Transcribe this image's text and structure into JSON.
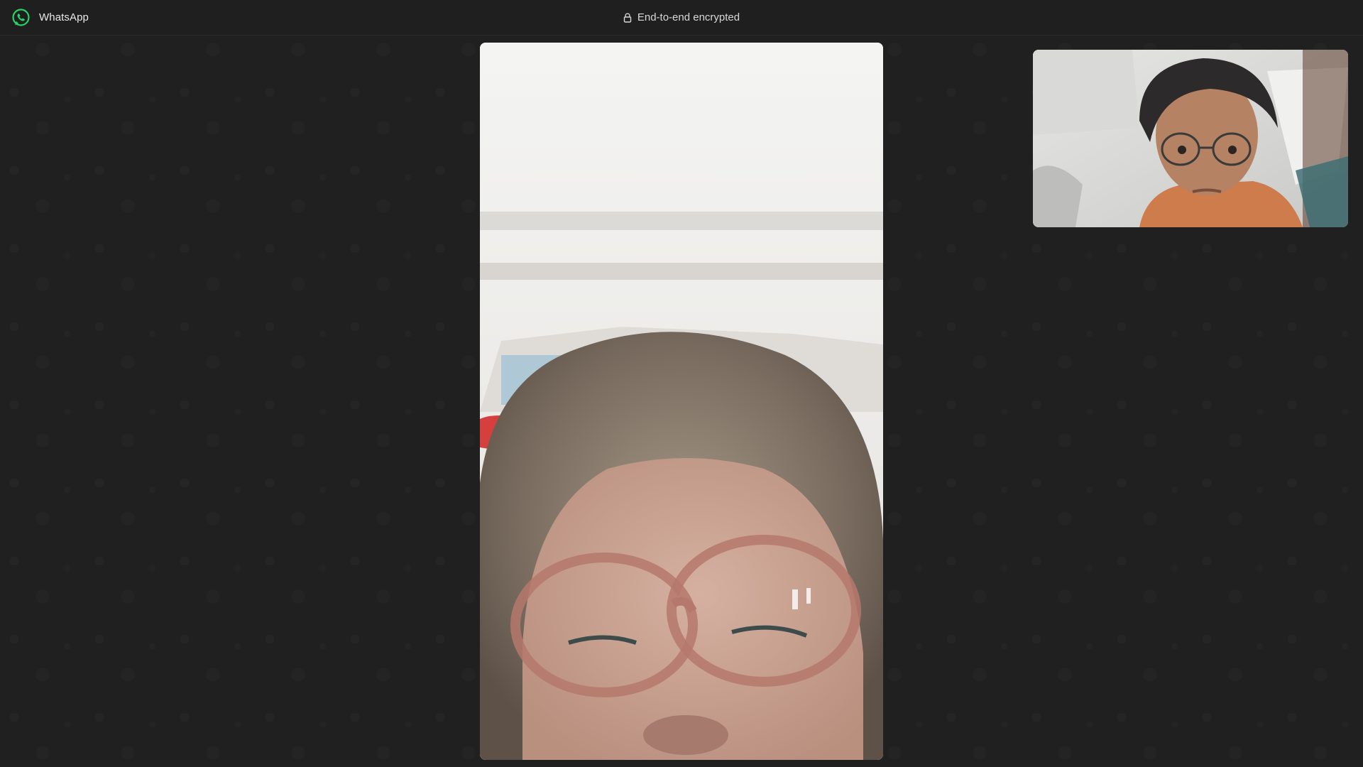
{
  "window": {
    "app_name": "WhatsApp",
    "encryption_label": "End-to-end encrypted"
  },
  "call": {
    "remote_video": {
      "icon": "remote-participant-video"
    },
    "self_video": {
      "icon": "self-preview-video"
    }
  },
  "colors": {
    "background": "#202020",
    "titlebar": "#1f1f1f",
    "brand_green": "#25d366",
    "text": "#e9e9e9"
  }
}
